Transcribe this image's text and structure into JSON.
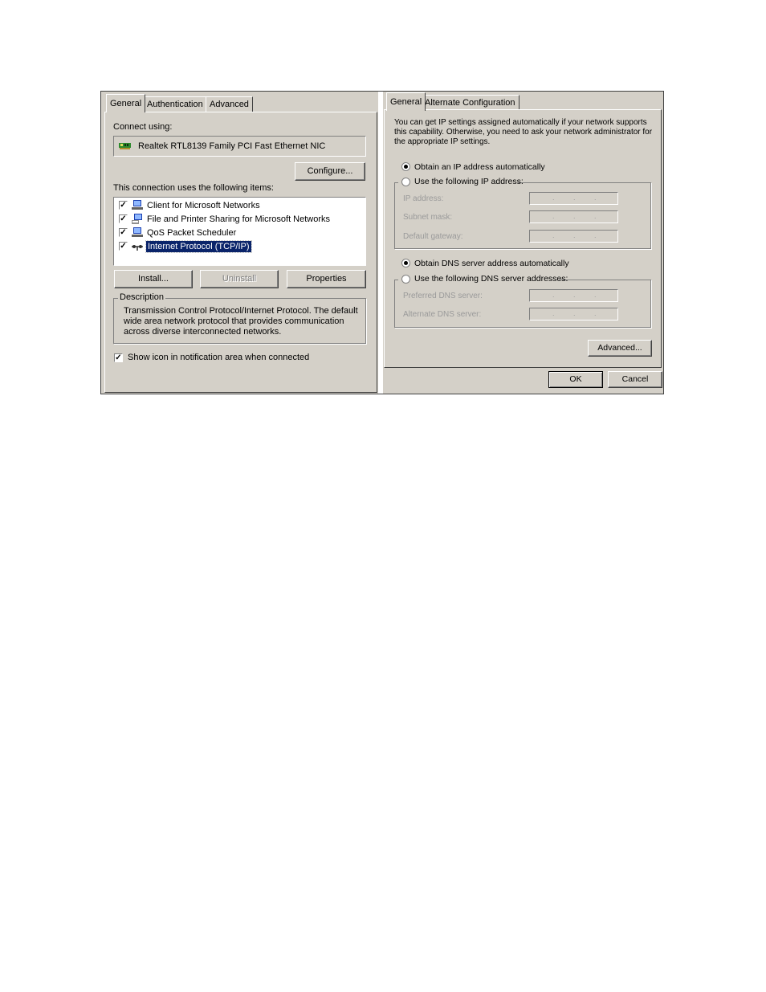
{
  "left_dialog": {
    "tabs": [
      {
        "label": "General",
        "active": true
      },
      {
        "label": "Authentication",
        "active": false
      },
      {
        "label": "Advanced",
        "active": false
      }
    ],
    "connect_using_label": "Connect using:",
    "adapter_name": "Realtek RTL8139 Family PCI Fast Ethernet NIC",
    "configure_label": "Configure...",
    "items_label": "This connection uses the following items:",
    "items": [
      {
        "label": "Client for Microsoft Networks",
        "checked": true,
        "icon": "network-client-icon"
      },
      {
        "label": "File and Printer Sharing for Microsoft Networks",
        "checked": true,
        "icon": "file-printer-sharing-icon"
      },
      {
        "label": "QoS Packet Scheduler",
        "checked": true,
        "icon": "qos-scheduler-icon"
      },
      {
        "label": "Internet Protocol (TCP/IP)",
        "checked": true,
        "selected": true,
        "icon": "protocol-icon"
      }
    ],
    "install_label": "Install...",
    "uninstall_label": "Uninstall",
    "properties_label": "Properties",
    "description_legend": "Description",
    "description_lines": [
      "Transmission Control Protocol/Internet Protocol. The default",
      "wide area network protocol that provides communication",
      "across diverse interconnected networks."
    ],
    "show_icon_label": "Show icon in notification area when connected",
    "show_icon_checked": true
  },
  "right_dialog": {
    "tabs": [
      {
        "label": "General",
        "active": true
      },
      {
        "label": "Alternate Configuration",
        "active": false
      }
    ],
    "intro_lines": [
      "You can get IP settings assigned automatically if your network supports",
      "this capability. Otherwise, you need to ask your network administrator for",
      "the appropriate IP settings."
    ],
    "obtain_ip_label": "Obtain an IP address automatically",
    "use_ip_label": "Use the following IP address:",
    "ip_address_label": "IP address:",
    "subnet_mask_label": "Subnet mask:",
    "default_gateway_label": "Default gateway:",
    "obtain_dns_label": "Obtain DNS server address automatically",
    "use_dns_label": "Use the following DNS server addresses:",
    "preferred_dns_label": "Preferred DNS server:",
    "alternate_dns_label": "Alternate DNS server:",
    "advanced_label": "Advanced...",
    "ok_label": "OK",
    "cancel_label": "Cancel"
  },
  "colors": {
    "dialog_bg": "#d4d0c8",
    "selection_bg": "#0a246a",
    "selection_text": "#ffffff",
    "disabled_text": "#9a9a9a"
  }
}
